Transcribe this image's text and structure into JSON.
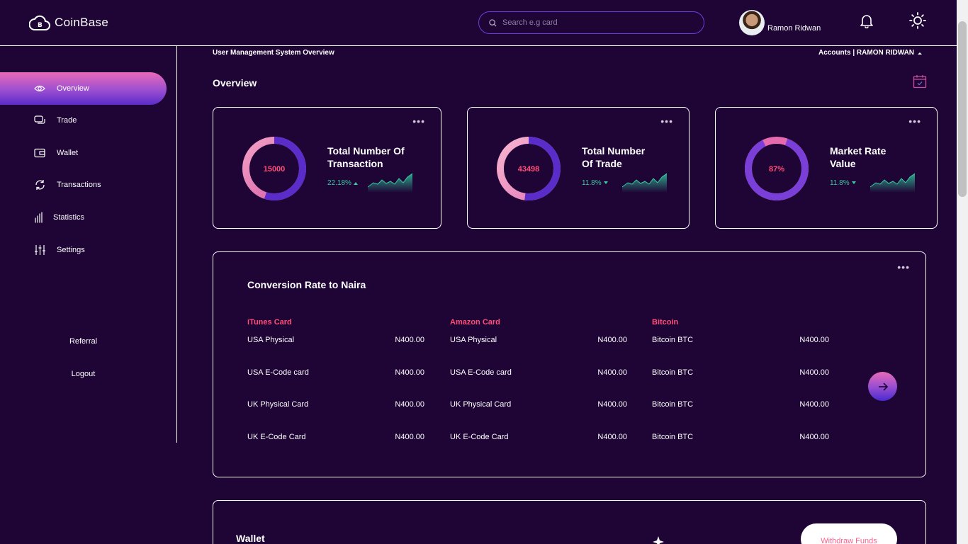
{
  "app": {
    "name": "CoinBase"
  },
  "header": {
    "search_placeholder": "Search e.g card",
    "user_name": "Ramon Ridwan"
  },
  "sidebar": {
    "items": [
      {
        "label": "Overview",
        "icon": "eye-icon",
        "active": true
      },
      {
        "label": "Trade",
        "icon": "chat-icon"
      },
      {
        "label": "Wallet",
        "icon": "wallet-icon"
      },
      {
        "label": "Transactions",
        "icon": "refresh-icon"
      },
      {
        "label": "Statistics",
        "icon": "bar-chart-icon"
      },
      {
        "label": "Settings",
        "icon": "sliders-icon"
      }
    ],
    "referral": "Referral",
    "logout": "Logout"
  },
  "main": {
    "breadcrumb": "User Management System Overview",
    "accounts": "Accounts | RAMON RIDWAN",
    "title": "Overview",
    "stats": [
      {
        "value": "15000",
        "title_line1": "Total Number Of",
        "title_line2": "Transaction",
        "change": "22.18%",
        "direction": "up",
        "ring_fraction": 0.55
      },
      {
        "value": "43498",
        "title_line1": "Total Number",
        "title_line2": "Of Trade",
        "change": "11.8%",
        "direction": "down",
        "ring_fraction": 0.52
      },
      {
        "value": "87%",
        "title_line1": "Market Rate",
        "title_line2": "Value",
        "change": "11.8%",
        "direction": "down",
        "ring_fraction": 0.87
      }
    ],
    "conversion": {
      "title": "Conversion Rate to Naira",
      "columns": [
        {
          "heading": "iTunes Card",
          "rows": [
            {
              "name": "USA Physical",
              "price": "N400.00"
            },
            {
              "name": "USA E-Code card",
              "price": "N400.00"
            },
            {
              "name": "UK Physical Card",
              "price": "N400.00"
            },
            {
              "name": "UK E-Code Card",
              "price": "N400.00"
            }
          ]
        },
        {
          "heading": "Amazon Card",
          "rows": [
            {
              "name": "USA Physical",
              "price": "N400.00"
            },
            {
              "name": "USA E-Code card",
              "price": "N400.00"
            },
            {
              "name": "UK Physical Card",
              "price": "N400.00"
            },
            {
              "name": "UK E-Code Card",
              "price": "N400.00"
            }
          ]
        },
        {
          "heading": "Bitcoin",
          "rows": [
            {
              "name": "Bitcoin BTC",
              "price": "N400.00"
            },
            {
              "name": "Bitcoin BTC",
              "price": "N400.00"
            },
            {
              "name": "Bitcoin BTC",
              "price": "N400.00"
            },
            {
              "name": "Bitcoin BTC",
              "price": "N400.00"
            }
          ]
        }
      ]
    },
    "wallet": {
      "title": "Wallet",
      "withdraw_label": "Withdraw Funds"
    }
  },
  "colors": {
    "background": "#1f0535",
    "accent_pink": "#ff4f79",
    "accent_purple": "#5a2cc9",
    "positive": "#3bc9a0"
  }
}
